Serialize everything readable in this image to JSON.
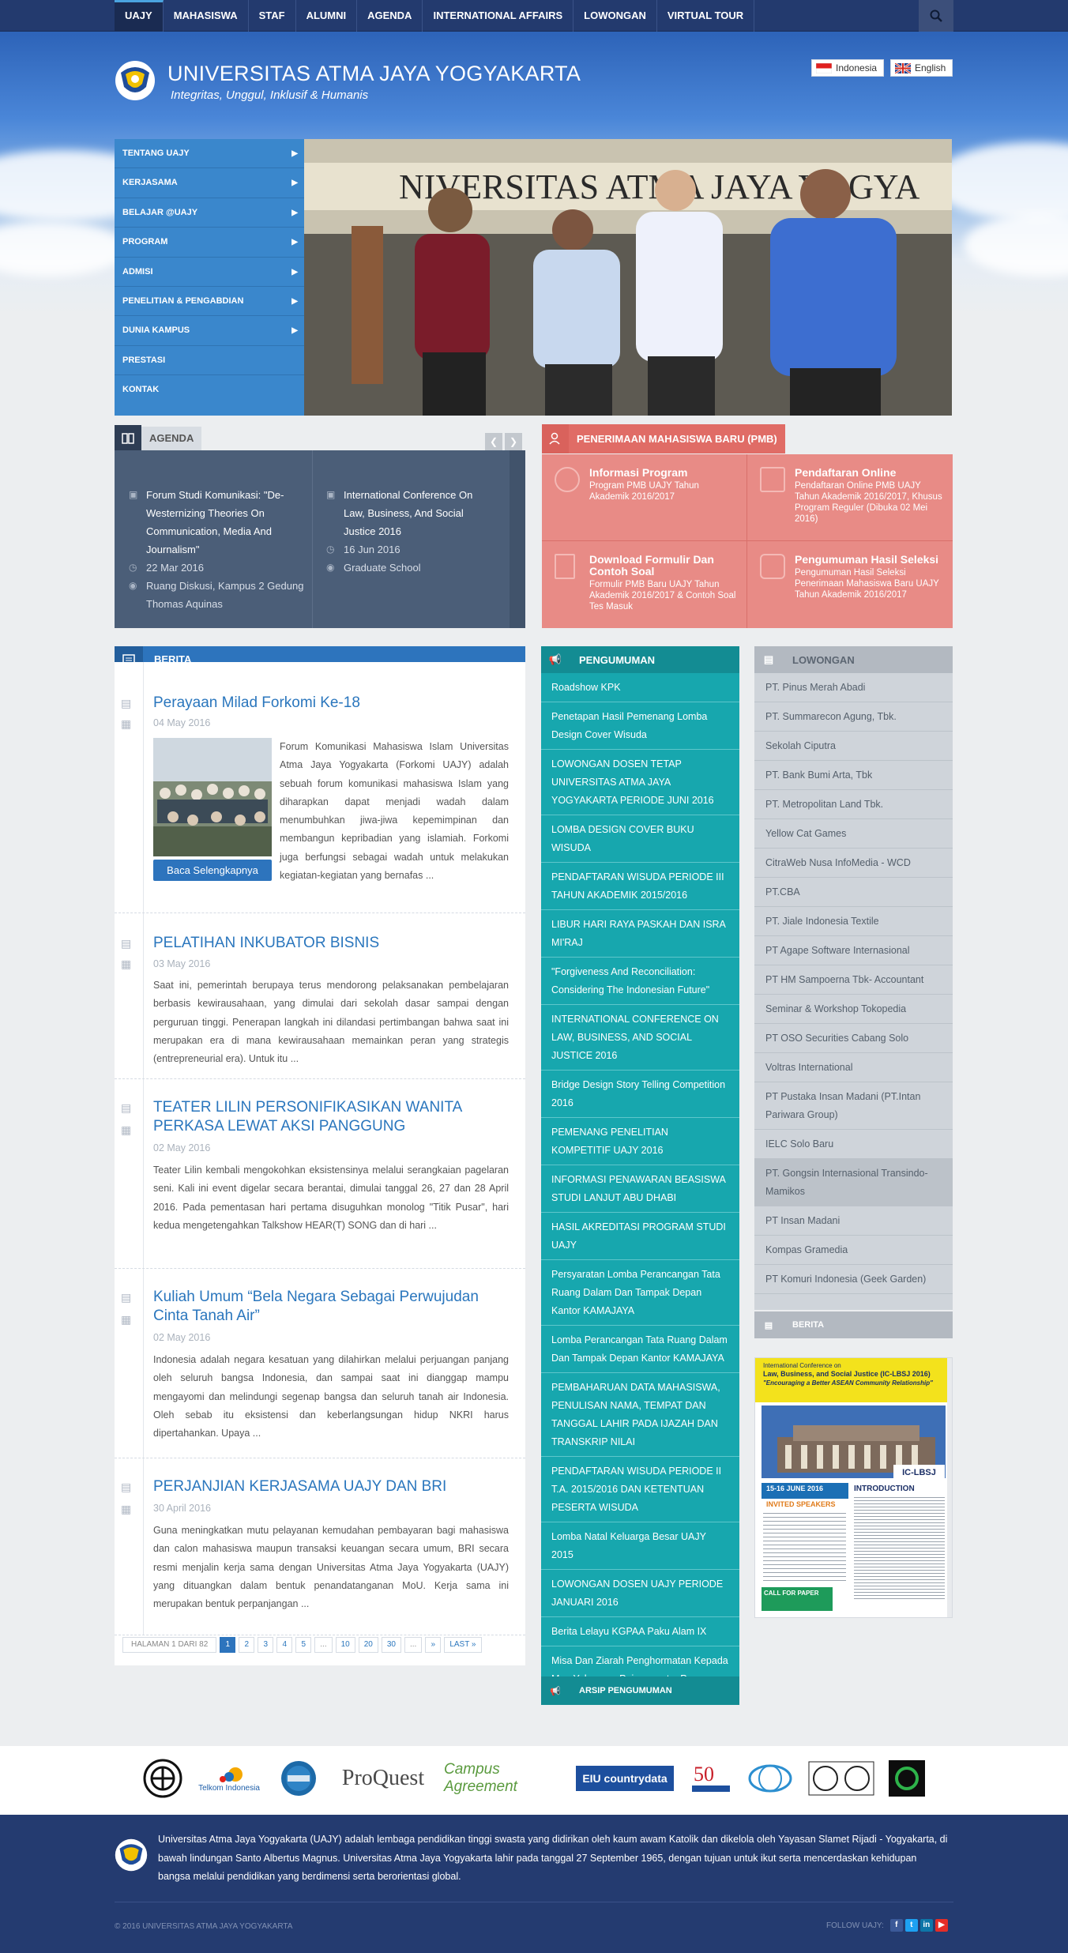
{
  "nav": {
    "items": [
      "UAJY",
      "MAHASISWA",
      "STAF",
      "ALUMNI",
      "AGENDA",
      "INTERNATIONAL AFFAIRS",
      "LOWONGAN",
      "VIRTUAL TOUR"
    ]
  },
  "header": {
    "title": "UNIVERSITAS ATMA JAYA YOGYAKARTA",
    "tagline": "Integritas, Unggul, Inklusif & Humanis",
    "lang_id": "Indonesia",
    "lang_en": "English"
  },
  "sidemenu": {
    "items": [
      "TENTANG UAJY",
      "KERJASAMA",
      "BELAJAR @UAJY",
      "PROGRAM",
      "ADMISI",
      "PENELITIAN & PENGABDIAN",
      "DUNIA KAMPUS",
      "PRESTASI",
      "KONTAK"
    ]
  },
  "agenda": {
    "label": "AGENDA",
    "events": [
      {
        "title": "Forum Studi Komunikasi: \"De-Westernizing Theories On Communication, Media And Journalism\"",
        "date": "22 Mar 2016",
        "place": "Ruang Diskusi, Kampus 2 Gedung Thomas Aquinas"
      },
      {
        "title": "International Conference On Law, Business, And Social Justice 2016",
        "date": "16 Jun 2016",
        "place": "Graduate School"
      }
    ]
  },
  "pmb": {
    "label": "PENERIMAAN MAHASISWA BARU (PMB)",
    "cells": [
      {
        "title": "Informasi Program",
        "desc": "Program PMB UAJY Tahun Akademik 2016/2017"
      },
      {
        "title": "Pendaftaran Online",
        "desc": "Pendaftaran Online PMB UAJY Tahun Akademik 2016/2017, Khusus Program Reguler (Dibuka 02 Mei 2016)"
      },
      {
        "title": "Download Formulir Dan Contoh Soal",
        "desc": "Formulir PMB Baru UAJY Tahun Akademik 2016/2017 & Contoh Soal Tes Masuk"
      },
      {
        "title": "Pengumuman Hasil Seleksi",
        "desc": "Pengumuman Hasil Seleksi Penerimaan Mahasiswa Baru UAJY Tahun Akademik 2016/2017"
      }
    ]
  },
  "berita": {
    "label": "BERITA",
    "readmore": "Baca Selengkapnya",
    "articles": [
      {
        "title": "Perayaan Milad Forkomi Ke-18",
        "date": "04 May 2016",
        "body": "Forum Komunikasi Mahasiswa Islam Universitas Atma Jaya Yogyakarta (Forkomi UAJY) adalah sebuah forum komunikasi mahasiswa Islam yang diharapkan dapat menjadi wadah dalam menumbuhkan jiwa-jiwa kepemimpinan dan membangun kepribadian yang islamiah. Forkomi juga berfungsi sebagai wadah untuk melakukan kegiatan-kegiatan yang bernafas ..."
      },
      {
        "title": "PELATIHAN INKUBATOR BISNIS",
        "date": "03 May 2016",
        "body": "Saat ini, pemerintah berupaya terus mendorong  pelaksanakan pembelajaran berbasis kewirausahaan, yang dimulai dari sekolah dasar sampai dengan perguruan tinggi. Penerapan langkah ini dilandasi pertimbangan bahwa saat ini merupakan era di mana  kewirausahaan memainkan peran yang strategis (entrepreneurial era). Untuk itu ..."
      },
      {
        "title": "TEATER LILIN PERSONIFIKASIKAN WANITA PERKASA LEWAT AKSI PANGGUNG",
        "date": "02 May 2016",
        "body": "Teater Lilin kembali mengokohkan eksistensinya melalui  serangkaian pagelaran seni. Kali ini event  digelar secara berantai,  dimulai tanggal 26, 27 dan  28 April 2016. Pada pementasan hari pertama disuguhkan monolog \"Titik Pusar\", hari kedua mengetengahkan Talkshow HEAR(T) SONG dan di hari ..."
      },
      {
        "title": "Kuliah Umum “Bela Negara Sebagai Perwujudan Cinta Tanah Air”",
        "date": "02 May 2016",
        "body": "Indonesia adalah negara kesatuan yang dilahirkan melalui perjuangan panjang oleh seluruh bangsa Indonesia, dan sampai saat ini dianggap mampu mengayomi dan melindungi segenap bangsa dan seluruh tanah air Indonesia. Oleh sebab itu eksistensi dan keberlangsungan hidup NKRI harus dipertahankan. Upaya ..."
      },
      {
        "title": "PERJANJIAN KERJASAMA UAJY DAN BRI",
        "date": "30 April 2016",
        "body": "Guna meningkatkan mutu pelayanan kemudahan pembayaran bagi mahasiswa dan calon mahasiswa maupun transaksi keuangan secara umum, BRI secara resmi menjalin kerja sama dengan Universitas Atma Jaya Yogyakarta (UAJY) yang dituangkan dalam bentuk penandatanganan MoU. Kerja sama ini merupakan bentuk perpanjangan ..."
      }
    ]
  },
  "pager": {
    "label": "HALAMAN 1 DARI 82",
    "pages": [
      "1",
      "2",
      "3",
      "4",
      "5",
      "...",
      "10",
      "20",
      "30",
      "...",
      "»",
      "LAST »"
    ]
  },
  "pengumuman": {
    "label": "PENGUMUMAN",
    "archive": "ARSIP PENGUMUMAN",
    "items": [
      "Roadshow KPK",
      "Penetapan Hasil Pemenang Lomba Design Cover Wisuda",
      "LOWONGAN DOSEN TETAP UNIVERSITAS ATMA JAYA YOGYAKARTA PERIODE JUNI 2016",
      "LOMBA DESIGN COVER BUKU WISUDA",
      "PENDAFTARAN WISUDA PERIODE III TAHUN AKADEMIK 2015/2016",
      "LIBUR HARI RAYA PASKAH DAN ISRA MI'RAJ",
      "\"Forgiveness And Reconciliation: Considering The Indonesian Future\"",
      "INTERNATIONAL CONFERENCE ON LAW, BUSINESS, AND SOCIAL JUSTICE 2016",
      "Bridge Design Story Telling Competition 2016",
      "PEMENANG PENELITIAN KOMPETITIF UAJY 2016",
      "INFORMASI PENAWARAN BEASISWA STUDI LANJUT ABU DHABI",
      "HASIL AKREDITASI PROGRAM STUDI UAJY",
      "Persyaratan Lomba Perancangan Tata Ruang Dalam Dan Tampak Depan Kantor KAMAJAYA",
      "Lomba Perancangan Tata Ruang Dalam Dan Tampak Depan Kantor KAMAJAYA",
      "PEMBAHARUAN DATA MAHASISWA, PENULISAN NAMA, TEMPAT DAN TANGGAL LAHIR PADA IJAZAH DAN TRANSKRIP NILAI",
      "PENDAFTARAN WISUDA PERIODE II T.A. 2015/2016 DAN KETENTUAN PESERTA WISUDA",
      "Lomba Natal Keluarga Besar UAJY 2015",
      "LOWONGAN DOSEN UAJY PERIODE JANUARI 2016",
      "Berita Lelayu KGPAA Paku Alam IX",
      "Misa Dan Ziarah Penghormatan Kepada Mgr. Yohannes Pujosumarta, Pr."
    ]
  },
  "lowongan": {
    "label": "LOWONGAN",
    "berita_label": "BERITA",
    "items": [
      "PT. Pinus Merah Abadi",
      "PT. Summarecon Agung, Tbk.",
      "Sekolah Ciputra",
      "PT. Bank Bumi Arta, Tbk",
      "PT. Metropolitan Land Tbk.",
      "Yellow Cat Games",
      "CitraWeb Nusa InfoMedia - WCD",
      "PT.CBA",
      "PT. Jiale Indonesia Textile",
      "PT Agape Software Internasional",
      "PT HM Sampoerna Tbk- Accountant",
      "Seminar & Workshop Tokopedia",
      "PT OSO Securities Cabang Solo",
      "Voltras International",
      "PT Pustaka Insan Madani (PT.Intan Pariwara Group)",
      "IELC Solo Baru",
      "PT. Gongsin Internasional Transindo-Mamikos",
      "PT Insan Madani",
      "Kompas Gramedia",
      "PT Komuri Indonesia (Geek Garden)"
    ],
    "poster": {
      "line1": "International Conference on",
      "line2": "Law, Business, and Social Justice (IC-LBSJ 2016)",
      "line3": "\"Encouraging a Better ASEAN Community Relationship\"",
      "badge": "IC-LBSJ",
      "date": "15-16 JUNE 2016",
      "speakers": "INVITED SPEAKERS",
      "intro": "INTRODUCTION",
      "call": "CALL FOR PAPER"
    }
  },
  "partners": {
    "telkom": "Telkom Indonesia",
    "proquest": "ProQuest",
    "campus": "Campus Agreement",
    "eiu": "EIU countrydata"
  },
  "footer": {
    "about": "Universitas Atma Jaya Yogyakarta (UAJY) adalah lembaga pendidikan tinggi swasta yang didirikan oleh kaum awam Katolik dan dikelola oleh Yayasan Slamet Rijadi - Yogyakarta, di bawah lindungan Santo Albertus Magnus. Universitas Atma Jaya Yogyakarta lahir pada tanggal 27 September 1965, dengan tujuan untuk ikut serta mencerdaskan kehidupan bangsa melalui pendidikan yang berdimensi serta berorientasi global.",
    "copyright": "© 2016 UNIVERSITAS ATMA JAYA YOGYAKARTA",
    "follow": "FOLLOW UAJY:"
  },
  "colors": {
    "nav": "#233a6e",
    "menu": "#3a87cc",
    "agenda": "#4b5e78",
    "pmb": "#e88b86",
    "pengumuman": "#17a7ae",
    "lowongan": "#cfd4da",
    "footer": "#243b70"
  }
}
